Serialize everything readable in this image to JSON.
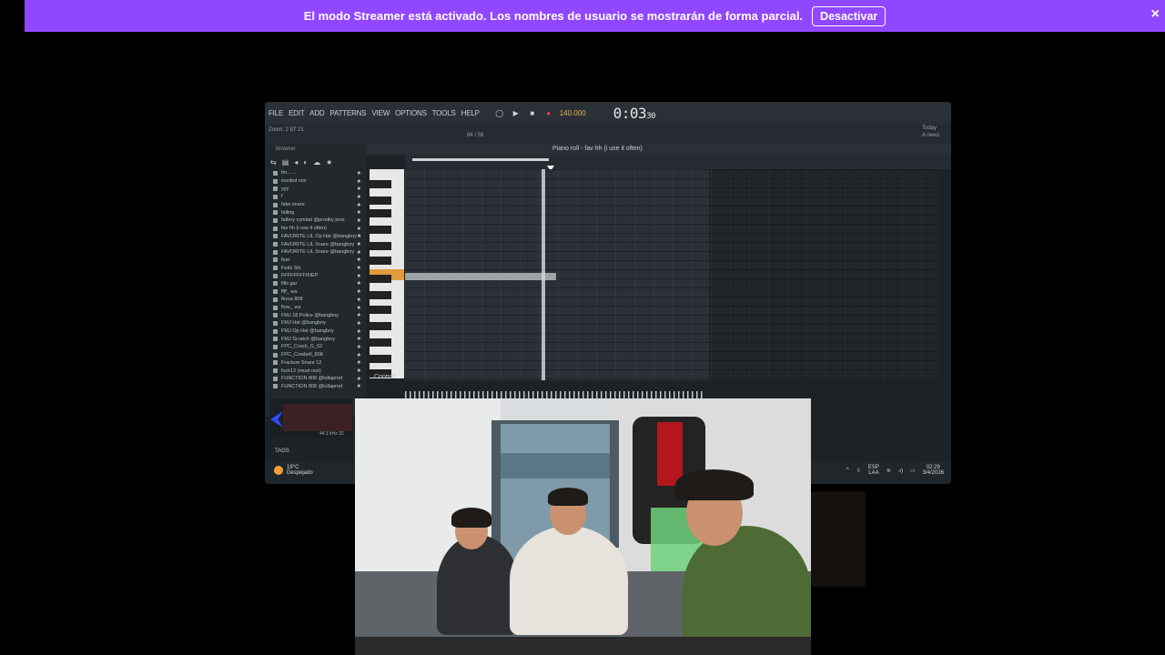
{
  "banner": {
    "message": "El modo Streamer está activado. Los nombres de usuario se mostrarán de forma parcial.",
    "button_label": "Desactivar",
    "close_symbol": "×",
    "color": "#9147ff"
  },
  "fl": {
    "menu": [
      "FILE",
      "EDIT",
      "ADD",
      "PATTERNS",
      "VIEW",
      "OPTIONS",
      "TOOLS",
      "HELP"
    ],
    "tempo": "140.000",
    "clock_main": "0:03",
    "clock_sub": "30",
    "hint_left": "Zoom: 2 87 21",
    "pattern_count": "84 / 59",
    "piano_roll_title": "Piano roll - fav hh (i use it often)",
    "browser_label": "Browser",
    "browser_items": [
      "fm... ...",
      "excited vox",
      "yyy",
      "f",
      "fake snare",
      "falling",
      "fatboy cymbal @prodby jens",
      "fav hh (i use it often)",
      "FAVORITE LIL Op Hat @bangboy",
      "FAVORITE LIL Snare @bangboy",
      "FAVORITE LIL Snare @bangboy",
      "fear",
      "Feds Sfx",
      "FFFFFFFFIIIIEP",
      "fills gar",
      "ffff_ wa",
      "fkvsa 808",
      "flow_ wa",
      "FMJ 18 Police @bangboy",
      "FMJ Hat @bangboy",
      "FMJ Op Hat @bangboy",
      "FMJ Scratch @bangboy",
      "FPC_Crash_G_02",
      "FPC_Cowbell_808",
      "Fracture Snare 12",
      "fuck12 (must use)",
      "FUNCTION 808 @lullaprod",
      "FUNCTION 808 @lullaprod"
    ],
    "highlighted_key": "C5",
    "control_label": "Control",
    "sample_info": "44.1 kHz 32",
    "tag_label": "TAGS",
    "weather_temp": "19°C",
    "weather_desc": "Despejado",
    "lang_1": "ESP",
    "lang_2": "LAA",
    "time": "02:29",
    "date": "3/4/2026",
    "today": "Today",
    "news": "A news"
  }
}
